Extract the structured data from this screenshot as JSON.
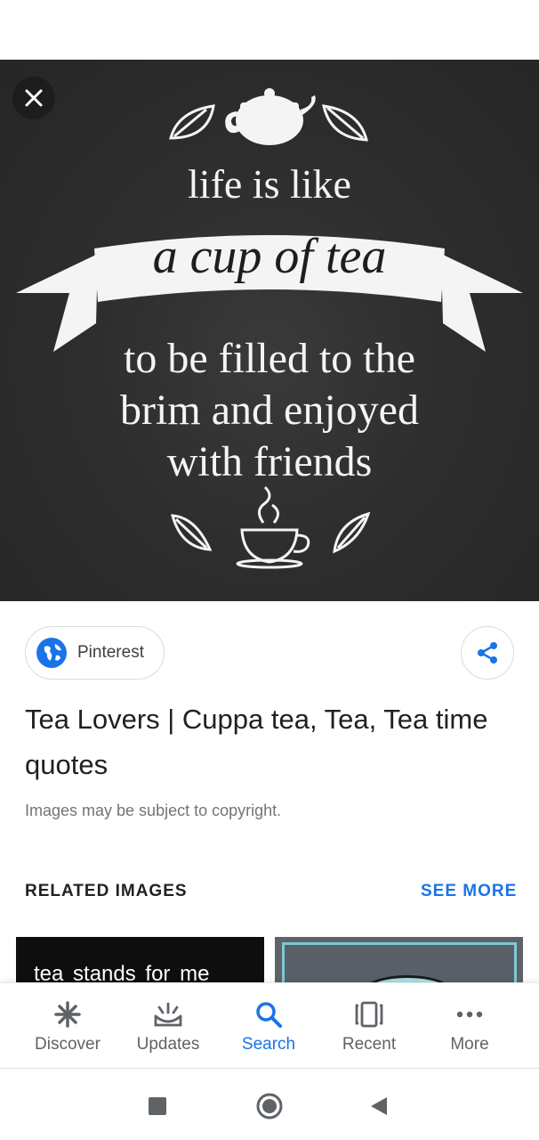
{
  "hero": {
    "quote_line1": "life is like",
    "quote_line2": "a cup of tea",
    "quote_line3": "to be filled to the",
    "quote_line4": "brim and enjoyed",
    "quote_line5": "with friends"
  },
  "source": {
    "label": "Pinterest"
  },
  "result": {
    "title": "Tea Lovers | Cuppa tea, Tea, Tea time quotes",
    "copyright": "Images may be subject to copyright."
  },
  "related": {
    "heading": "RELATED IMAGES",
    "see_more": "SEE MORE",
    "thumb1_text": "tea stands for me"
  },
  "bottom_nav": {
    "items": [
      {
        "label": "Discover",
        "icon": "asterisk-icon"
      },
      {
        "label": "Updates",
        "icon": "updates-icon"
      },
      {
        "label": "Search",
        "icon": "search-icon",
        "active": true
      },
      {
        "label": "Recent",
        "icon": "recent-tabs-icon"
      },
      {
        "label": "More",
        "icon": "more-dots-icon"
      }
    ]
  },
  "colors": {
    "accent": "#1a73e8",
    "chalkboard": "#2e2e2e",
    "text": "#202124",
    "muted": "#70757a"
  }
}
